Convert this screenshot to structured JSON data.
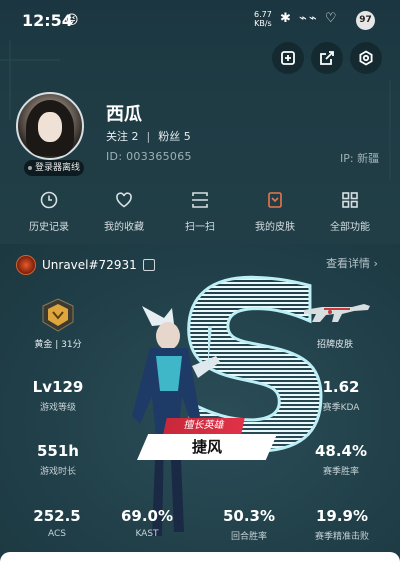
{
  "statusbar": {
    "time": "12:54",
    "emoji": "😝",
    "netspeed_value": "6.77",
    "netspeed_unit": "KB/s",
    "battery": "97",
    "icons": [
      "bluetooth-icon",
      "signal-icon",
      "heart-icon"
    ]
  },
  "profile": {
    "name": "西瓜",
    "follow_label": "关注 2",
    "fans_label": "粉丝 5",
    "id_label": "ID:",
    "id": "003365065",
    "ip_label": "IP:",
    "ip": "新疆",
    "online_badge": "登录器离线"
  },
  "menu": [
    {
      "label": "历史记录",
      "icon": "history-icon"
    },
    {
      "label": "我的收藏",
      "icon": "heart-icon"
    },
    {
      "label": "扫一扫",
      "icon": "scan-icon"
    },
    {
      "label": "我的皮肤",
      "icon": "skin-icon"
    },
    {
      "label": "全部功能",
      "icon": "grid-icon"
    }
  ],
  "game": {
    "account": "Unravel#72931",
    "details": "查看详情",
    "rank_label": "黄金 | 31分",
    "skin_label": "招牌皮肤",
    "hero_tag": "擅长英雄",
    "hero_name": "捷风",
    "big_letter": "S"
  },
  "stats": {
    "level": {
      "value": "Lv129",
      "label": "游戏等级"
    },
    "kda": {
      "value": "1.62",
      "label": "赛季KDA"
    },
    "playtime": {
      "value": "551h",
      "label": "游戏时长"
    },
    "winrate": {
      "value": "48.4%",
      "label": "赛季胜率"
    },
    "acs": {
      "value": "252.5",
      "label": "ACS"
    },
    "kast": {
      "value": "69.0%",
      "label": "KAST"
    },
    "round_win": {
      "value": "50.3%",
      "label": "回合胜率"
    },
    "headshot": {
      "value": "19.9%",
      "label": "赛季精准击败"
    }
  },
  "colors": {
    "accent_red": "#e03248",
    "gold": "#d9a441",
    "bg": "#213e47"
  }
}
